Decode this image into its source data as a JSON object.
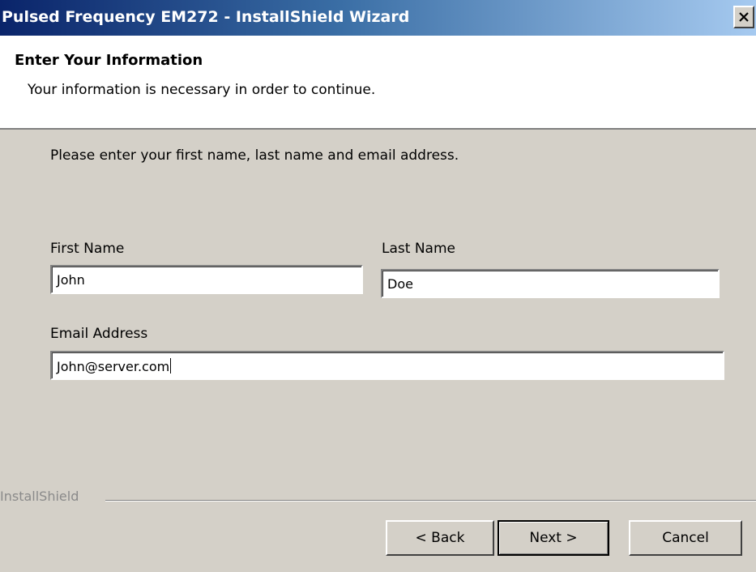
{
  "window": {
    "title": "Pulsed Frequency EM272 - InstallShield Wizard",
    "close_icon": "close-icon"
  },
  "header": {
    "title": "Enter Your Information",
    "subtitle": "Your information is necessary in order to continue."
  },
  "main": {
    "instruction": "Please enter your first name, last name and email address.",
    "first_name": {
      "label": "First Name",
      "value": "John"
    },
    "last_name": {
      "label": "Last Name",
      "value": "Doe"
    },
    "email": {
      "label": "Email Address",
      "value": "John@server.com"
    }
  },
  "footer": {
    "brand": "InstallShield",
    "back_label": "< Back",
    "next_label": "Next >",
    "cancel_label": "Cancel"
  },
  "colors": {
    "title_gradient_start": "#0a246a",
    "title_gradient_end": "#a6caf0",
    "dialog_face": "#d4d0c8",
    "header_background": "#ffffff"
  }
}
